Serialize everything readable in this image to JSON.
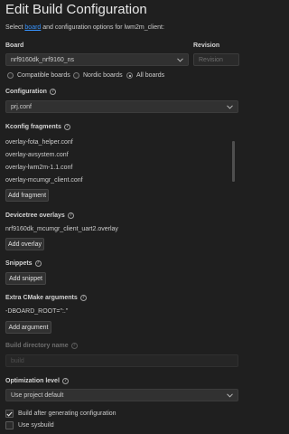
{
  "header": {
    "title": "Edit Build Configuration",
    "subtitle_prefix": "Select ",
    "subtitle_link": "board",
    "subtitle_suffix": " and configuration options for lwm2m_client:"
  },
  "board": {
    "label": "Board",
    "value": "nrf9160dk_nrf9160_ns",
    "revision_label": "Revision",
    "revision_placeholder": "Revision",
    "filter_options": [
      {
        "label": "Compatible boards",
        "selected": false
      },
      {
        "label": "Nordic boards",
        "selected": false
      },
      {
        "label": "All boards",
        "selected": true
      }
    ]
  },
  "configuration": {
    "label": "Configuration",
    "value": "prj.conf"
  },
  "kconfig": {
    "label": "Kconfig fragments",
    "items": [
      "overlay-fota_helper.conf",
      "overlay-avsystem.conf",
      "overlay-lwm2m-1.1.conf",
      "overlay-mcumgr_client.conf"
    ],
    "add_label": "Add fragment"
  },
  "devicetree": {
    "label": "Devicetree overlays",
    "items": [
      "nrf9160dk_mcumgr_client_uart2.overlay"
    ],
    "add_label": "Add overlay"
  },
  "snippets": {
    "label": "Snippets",
    "add_label": "Add snippet"
  },
  "cmake": {
    "label": "Extra CMake arguments",
    "items": [
      "-DBOARD_ROOT=\":.\""
    ],
    "add_label": "Add argument"
  },
  "build_dir": {
    "label": "Build directory name",
    "placeholder": "build"
  },
  "optimization": {
    "label": "Optimization level",
    "value": "Use project default"
  },
  "options": {
    "build_after": {
      "label": "Build after generating configuration",
      "checked": true
    },
    "sysbuild": {
      "label": "Use sysbuild",
      "checked": false
    }
  },
  "colors": {
    "background": "#1f1f1f",
    "link": "#3794ff",
    "input_bg": "#313131"
  }
}
